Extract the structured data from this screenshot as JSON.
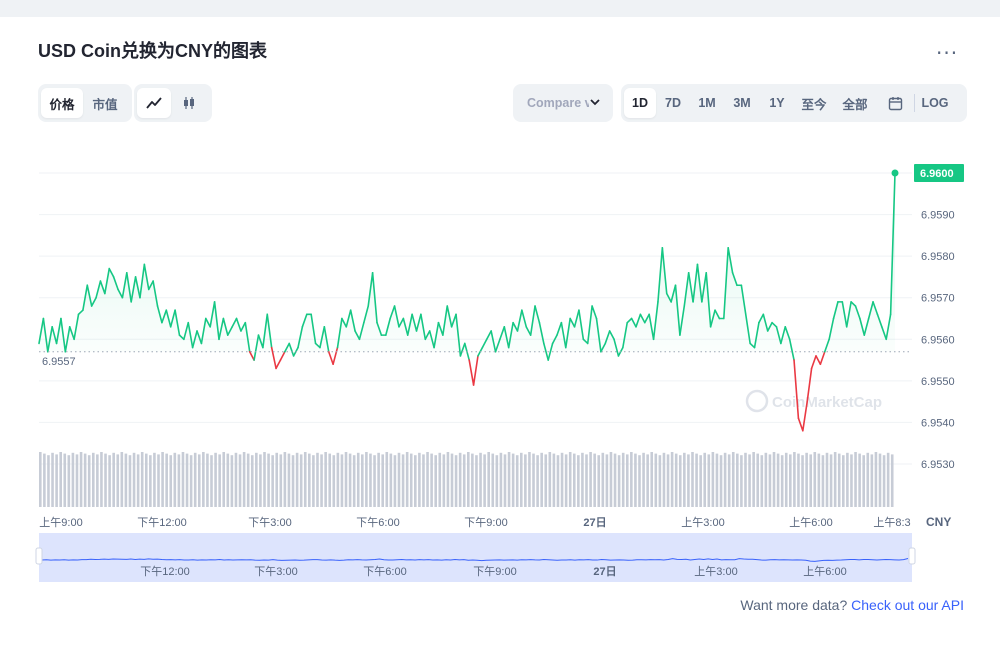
{
  "title": "USD Coin兑换为CNY的图表",
  "more_label": "...",
  "toolbar": {
    "price_label": "价格",
    "mcap_label": "市值",
    "compare_label": "Compare v",
    "ranges": [
      "1D",
      "7D",
      "1M",
      "3M",
      "1Y",
      "至今",
      "全部"
    ],
    "active_range": "1D",
    "log_label": "LOG"
  },
  "chart_data": {
    "type": "line",
    "series": [
      {
        "values": [
          6.9559,
          6.9565,
          6.9557,
          6.9563,
          6.9559,
          6.9565,
          6.9557,
          6.9563,
          6.956,
          6.9566,
          6.9567,
          6.9573,
          6.9568,
          6.957,
          6.9574,
          6.9571,
          6.9577,
          6.9575,
          6.9572,
          6.957,
          6.9576,
          6.9569,
          6.9575,
          6.957,
          6.9578,
          6.9572,
          6.9574,
          6.9568,
          6.9564,
          6.9567,
          6.9563,
          6.9567,
          6.9561,
          6.956,
          6.9564,
          6.9558,
          6.9562,
          6.9559,
          6.9565,
          6.9563,
          6.9569,
          6.956,
          6.9565,
          6.9561,
          6.9563,
          6.9565,
          6.9562,
          6.9564,
          6.9557,
          6.9555,
          6.9561,
          6.9558,
          6.9566,
          6.9558,
          6.9553,
          6.9555,
          6.9557,
          6.9559,
          6.9556,
          6.9558,
          6.9563,
          6.9566,
          6.9566,
          6.9559,
          6.9558,
          6.9563,
          6.9557,
          6.9554,
          6.9558,
          6.9565,
          6.9563,
          6.9567,
          6.9562,
          6.956,
          6.9564,
          6.9568,
          6.9576,
          6.9564,
          6.9561,
          6.9561,
          6.9565,
          6.9568,
          6.9563,
          6.9565,
          6.9561,
          6.9566,
          6.9562,
          6.9566,
          6.956,
          6.9562,
          6.9558,
          6.9564,
          6.9561,
          6.9568,
          6.9563,
          6.9566,
          6.9556,
          6.9559,
          6.9555,
          6.9549,
          6.9556,
          6.9558,
          6.956,
          6.9562,
          6.9557,
          6.956,
          6.9563,
          6.9558,
          6.9564,
          6.9562,
          6.9567,
          6.9563,
          6.9561,
          6.9568,
          6.9564,
          6.9559,
          6.9555,
          6.9559,
          6.9561,
          6.9564,
          6.9558,
          6.9565,
          6.9563,
          6.9567,
          6.956,
          6.9559,
          6.9568,
          6.9565,
          6.9557,
          6.9559,
          6.9562,
          6.956,
          6.9556,
          6.9558,
          6.9564,
          6.9565,
          6.9563,
          6.9566,
          6.9564,
          6.9566,
          6.956,
          6.9569,
          6.9582,
          6.9571,
          6.9569,
          6.9573,
          6.9561,
          6.9568,
          6.9576,
          6.9569,
          6.9578,
          6.9569,
          6.9576,
          6.9563,
          6.9567,
          6.9565,
          6.9565,
          6.9582,
          6.9576,
          6.9573,
          6.9573,
          6.9566,
          6.9559,
          6.9558,
          6.9564,
          6.9566,
          6.9562,
          6.9564,
          6.9563,
          6.9559,
          6.9563,
          6.956,
          6.9555,
          6.9541,
          6.9538,
          6.9545,
          6.9553,
          6.9556,
          6.9554,
          6.9557,
          6.956,
          6.9565,
          6.9569,
          6.9569,
          6.9563,
          6.9569,
          6.9568,
          6.9565,
          6.9561,
          6.9565,
          6.9569,
          6.9566,
          6.9563,
          6.956,
          6.9566,
          6.96
        ]
      }
    ],
    "reference_value": 6.9557,
    "reference_label": "6.9557",
    "last_value_label": "6.9600",
    "yticks": [
      "6.9590",
      "6.9580",
      "6.9570",
      "6.9560",
      "6.9550",
      "6.9540",
      "6.9530"
    ],
    "xticks": [
      "上午9:00",
      "下午12:00",
      "下午3:00",
      "下午6:00",
      "下午9:00",
      "27日",
      "上午3:00",
      "上午6:00",
      "上午8:3"
    ],
    "currency_label": "CNY",
    "navigator_ticks": [
      "下午12:00",
      "下午3:00",
      "下午6:00",
      "下午9:00",
      "27日",
      "上午3:00",
      "上午6:00"
    ],
    "ylim": [
      6.9525,
      6.9605
    ],
    "colors": {
      "up": "#16c784",
      "down": "#ea3943",
      "volume": "#c7ccd6",
      "navigator_fill": "#dde4fd",
      "navigator_line": "#3861fb"
    }
  },
  "watermark": "CoinMarketCap",
  "footer": {
    "text": "Want more data?",
    "link": "Check out our API"
  }
}
